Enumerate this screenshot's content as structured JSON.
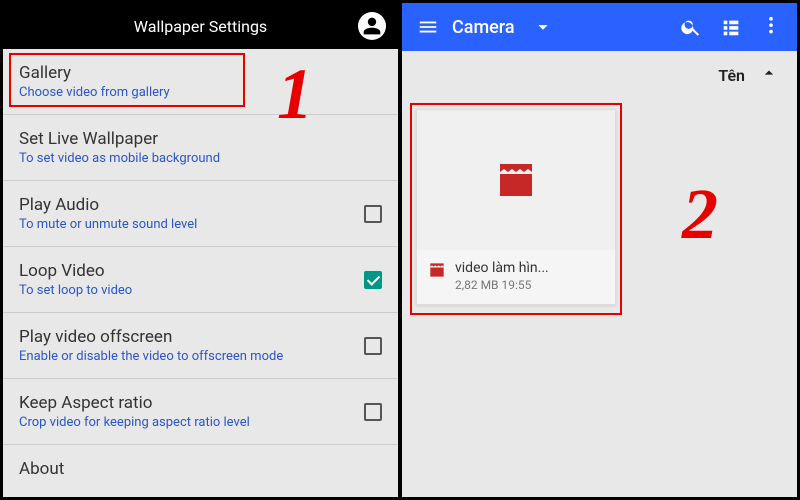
{
  "left": {
    "header_title": "Wallpaper Settings",
    "items": [
      {
        "title": "Gallery",
        "sub": "Choose video from gallery",
        "checkbox": null
      },
      {
        "title": "Set Live Wallpaper",
        "sub": "To set video as mobile background",
        "checkbox": null
      },
      {
        "title": "Play Audio",
        "sub": "To mute or unmute sound level",
        "checkbox": false
      },
      {
        "title": "Loop Video",
        "sub": "To set loop to video",
        "checkbox": true
      },
      {
        "title": "Play video offscreen",
        "sub": "Enable or disable the video to offscreen mode",
        "checkbox": false
      },
      {
        "title": "Keep Aspect ratio",
        "sub": "Crop video for keeping aspect ratio level",
        "checkbox": false
      },
      {
        "title": "About",
        "sub": "",
        "checkbox": null
      }
    ]
  },
  "right": {
    "header_title": "Camera",
    "sort_label": "Tên",
    "file": {
      "name": "video làm hìn...",
      "size": "2,82 MB",
      "time": "19:55"
    }
  },
  "annotations": {
    "num1": "1",
    "num2": "2"
  }
}
